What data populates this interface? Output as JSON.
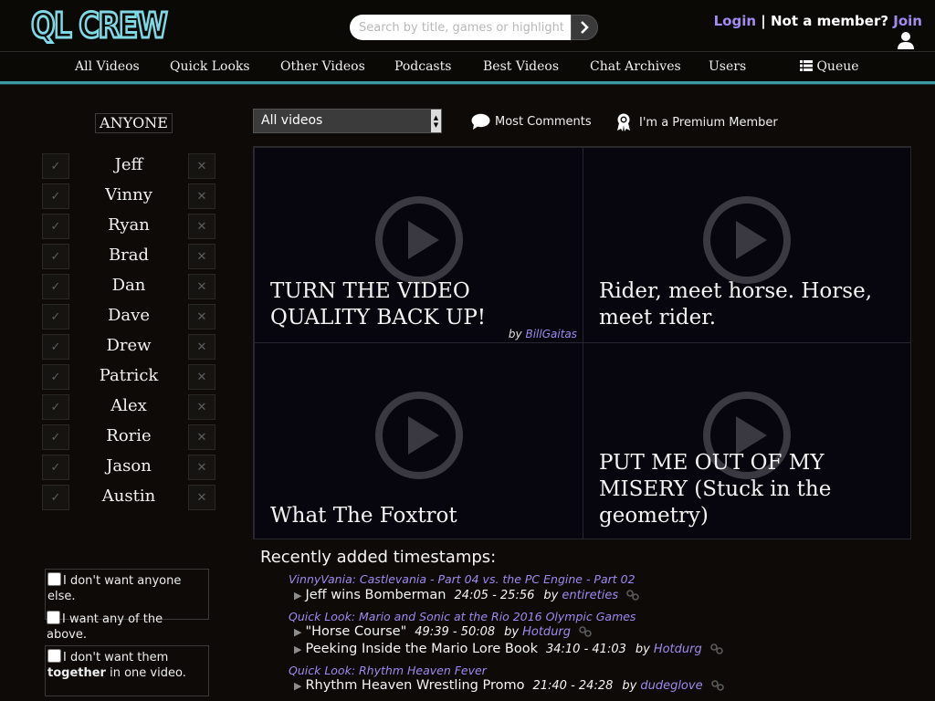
{
  "header": {
    "logo": "QL CREW",
    "search_placeholder": "Search by title, games or highlights.",
    "login": "Login",
    "separator": "|",
    "not_member": "Not a member?",
    "join": "Join"
  },
  "nav": [
    {
      "label": "All Videos"
    },
    {
      "label": "Quick Looks"
    },
    {
      "label": "Other Videos"
    },
    {
      "label": "Podcasts"
    },
    {
      "label": "Best Videos"
    },
    {
      "label": "Chat Archives"
    },
    {
      "label": "Users"
    },
    {
      "label": "Queue"
    }
  ],
  "sidebar": {
    "anyone": "ANYONE",
    "people": [
      "Jeff",
      "Vinny",
      "Ryan",
      "Brad",
      "Dan",
      "Dave",
      "Drew",
      "Patrick",
      "Alex",
      "Rorie",
      "Jason",
      "Austin"
    ],
    "options": [
      {
        "text": "I don't want anyone else."
      },
      {
        "text": "I want any of the above."
      },
      {
        "pre": "I don't want them",
        "bold": "together",
        "post": "in one video."
      }
    ]
  },
  "filters": {
    "select_value": "All videos",
    "most_comments": "Most Comments",
    "premium": "I'm a Premium Member"
  },
  "videos": [
    {
      "title": "TURN THE VIDEO QUALITY BACK UP!",
      "by": "by",
      "user": "BillGaitas"
    },
    {
      "title": "Rider, meet horse. Horse, meet rider."
    },
    {
      "title": "What The Foxtrot"
    },
    {
      "title": "PUT ME OUT OF MY MISERY (Stuck in the geometry)"
    }
  ],
  "timestamps": {
    "title": "Recently added timestamps:",
    "groups": [
      {
        "video": "VinnyVania: Castlevania - Part 04 vs. the PC Engine - Part 02",
        "items": [
          {
            "label": "Jeff wins Bomberman",
            "time": "24:05 - 25:56",
            "by": "by",
            "user": "entireties"
          }
        ]
      },
      {
        "video": "Quick Look: Mario and Sonic at the Rio 2016 Olympic Games",
        "items": [
          {
            "label": "\"Horse Course\"",
            "time": "49:39 - 50:08",
            "by": "by",
            "user": "Hotdurg"
          },
          {
            "label": "Peeking Inside the Mario Lore Book",
            "time": "34:10 - 41:03",
            "by": "by",
            "user": "Hotdurg"
          }
        ]
      },
      {
        "video": "Quick Look: Rhythm Heaven Fever",
        "items": [
          {
            "label": "Rhythm Heaven Wrestling Promo",
            "time": "21:40 - 24:28",
            "by": "by",
            "user": "dudeglove"
          }
        ]
      }
    ]
  }
}
